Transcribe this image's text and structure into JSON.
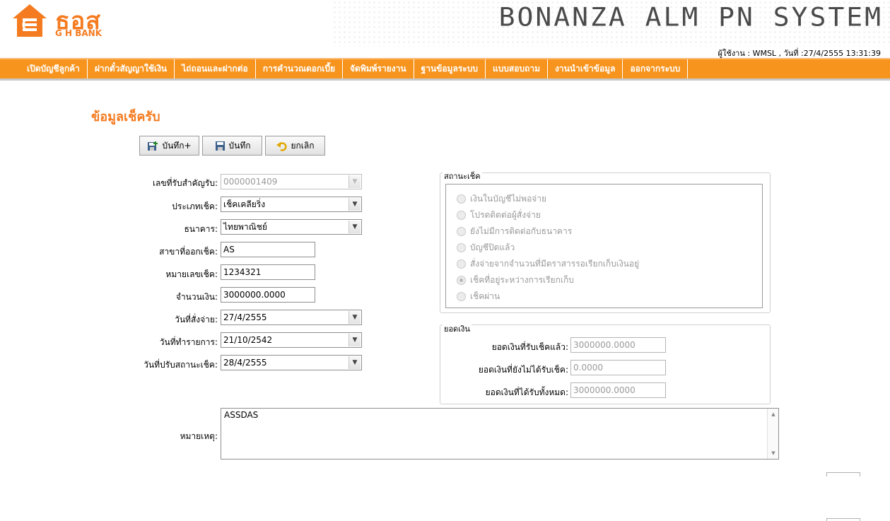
{
  "header": {
    "logo_th": "ธอส",
    "logo_en": "G H BANK",
    "system_title": "BONANZA ALM PN SYSTEM",
    "user_info": "ผู้ใช้งาน : WMSL , วันที่ :27/4/2555 13:31:39"
  },
  "menu": [
    "เปิดบัญชีลูกค้า",
    "ฝากตั๋วสัญญาใช้เงิน",
    "ไถ่ถอนและฝากต่อ",
    "การคำนวณดอกเบี้ย",
    "จัดพิมพ์รายงาน",
    "ฐานข้อมูลระบบ",
    "แบบสอบถาม",
    "งานนำเข้าข้อมูล",
    "ออกจากระบบ"
  ],
  "page_title": "ข้อมูลเช็ครับ",
  "toolbar": {
    "save_new": "บันทึก+",
    "save": "บันทึก",
    "cancel": "ยกเลิก"
  },
  "form": {
    "receipt_no_label": "เลขที่รับสำคัญรับ:",
    "receipt_no_value": "0000001409",
    "cheque_type_label": "ประเภทเช็ค:",
    "cheque_type_value": "เช็คเคลียริ่ง",
    "bank_label": "ธนาคาร:",
    "bank_value": "ไทยพาณิชย์",
    "branch_label": "สาขาที่ออกเช็ค:",
    "branch_value": "AS",
    "cheque_no_label": "หมายเลขเช็ค:",
    "cheque_no_value": "1234321",
    "amount_label": "จำนวนเงิน:",
    "amount_value": "3000000.0000",
    "pay_date_label": "วันที่สั่งจ่าย:",
    "pay_date_value": "27/4/2555",
    "txn_date_label": "วันที่ทำรายการ:",
    "txn_date_value": "21/10/2542",
    "status_date_label": "วันที่ปรับสถานะเช็ค:",
    "status_date_value": "28/4/2555",
    "note_label": "หมายเหตุ:",
    "note_value": "ASSDAS"
  },
  "cheque_status": {
    "legend": "สถานะเช็ค",
    "options": [
      "เงินในบัญชีไม่พอจ่าย",
      "โปรดติดต่อผู้สั่งจ่าย",
      "ยังไม่มีการติดต่อกับธนาคาร",
      "บัญชีปิดแล้ว",
      "สั่งจ่ายจากจำนวนที่มีตราสารรอเรียกเก็บเงินอยู่",
      "เช็คที่อยู่ระหว่างการเรียกเก็บ",
      "เช็คผ่าน"
    ],
    "selected_index": 5
  },
  "balance": {
    "legend": "ยอดเงิน",
    "received_label": "ยอดเงินที่รับเช็คแล้ว:",
    "received_value": "3000000.0000",
    "pending_label": "ยอดเงินที่ยังไม่ได้รับเช็ค:",
    "pending_value": "0.0000",
    "total_label": "ยอดเงินที่ได้รับทั้งหมด:",
    "total_value": "3000000.0000"
  },
  "colors": {
    "accent": "#f7941d",
    "title": "#f47b20"
  }
}
